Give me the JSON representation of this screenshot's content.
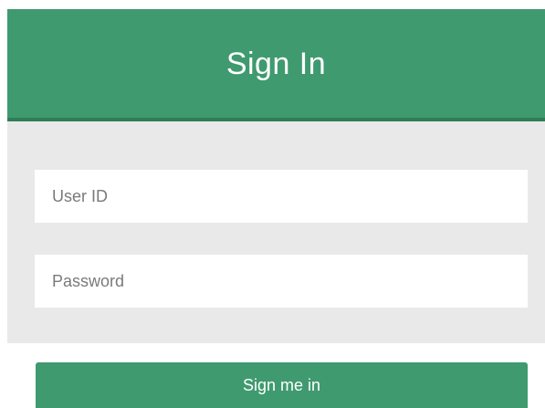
{
  "header": {
    "title": "Sign In"
  },
  "form": {
    "user_id_placeholder": "User ID",
    "password_placeholder": "Password",
    "submit_label": "Sign me in"
  },
  "colors": {
    "brand_green": "#3f9a6f",
    "header_border": "#2f7d57",
    "panel_background": "#e9e9ea",
    "field_background": "#ffffff"
  }
}
